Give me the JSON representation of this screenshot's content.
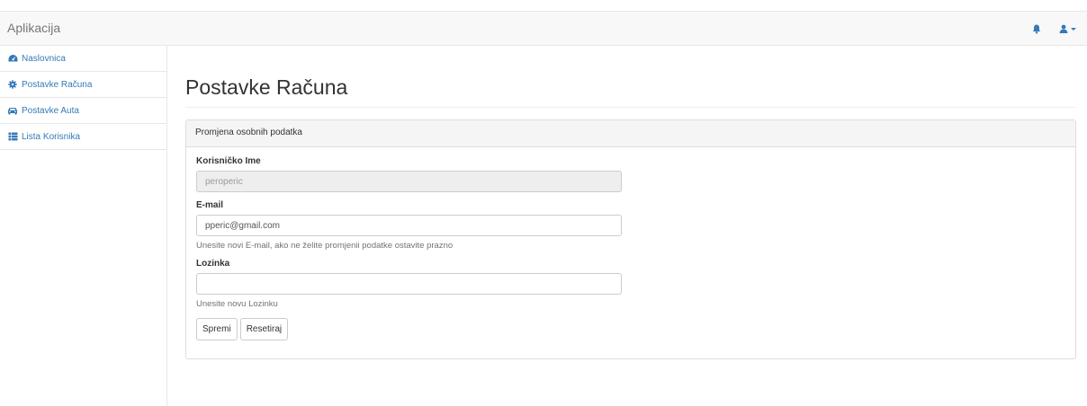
{
  "navbar": {
    "brand": "Aplikacija",
    "notifications_icon": "bell-icon",
    "user_icon": "user-icon"
  },
  "sidebar": {
    "items": [
      {
        "label": "Naslovnica",
        "icon": "dashboard-icon"
      },
      {
        "label": "Postavke Računa",
        "icon": "gear-icon"
      },
      {
        "label": "Postavke Auta",
        "icon": "car-icon"
      },
      {
        "label": "Lista Korisnika",
        "icon": "list-icon"
      }
    ]
  },
  "main": {
    "title": "Postavke Računa",
    "panel": {
      "heading": "Promjena osobnih podatka",
      "username": {
        "label": "Korisničko Ime",
        "value": "peroperic"
      },
      "email": {
        "label": "E-mail",
        "value": "pperic@gmail.com",
        "help": "Unesite novi E-mail, ako ne želite promjenii podatke ostavite prazno"
      },
      "password": {
        "label": "Lozinka",
        "value": "",
        "help": "Unesite novu Lozinku"
      },
      "buttons": {
        "save": "Spremi",
        "reset": "Resetiraj"
      }
    }
  },
  "colors": {
    "link": "#337ab7",
    "navbar_bg": "#f8f8f8",
    "border": "#dddddd"
  }
}
